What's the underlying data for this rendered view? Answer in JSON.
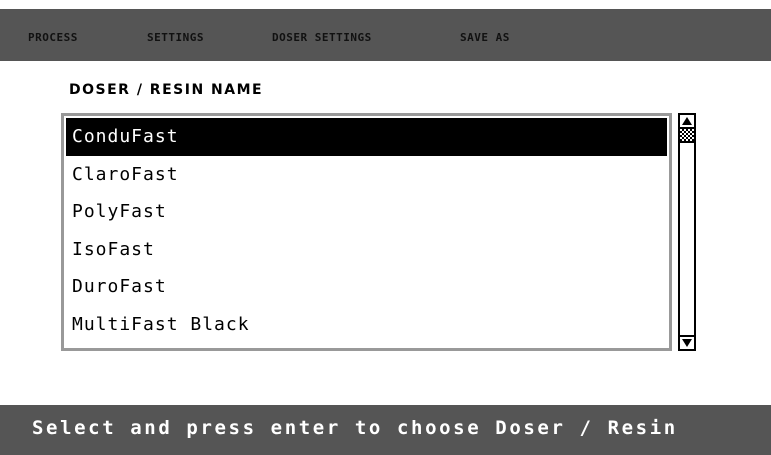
{
  "menu": {
    "items": [
      {
        "label": "PROCESS"
      },
      {
        "label": "SETTINGS"
      },
      {
        "label": "DOSER SETTINGS"
      },
      {
        "label": "SAVE AS"
      }
    ]
  },
  "section": {
    "title": "DOSER / RESIN NAME"
  },
  "list": {
    "selected": "ConduFast",
    "items": [
      {
        "label": "ConduFast"
      },
      {
        "label": "ClaroFast"
      },
      {
        "label": "PolyFast"
      },
      {
        "label": "IsoFast"
      },
      {
        "label": "DuroFast"
      },
      {
        "label": "MultiFast Black"
      }
    ]
  },
  "scrollbar": {
    "up_icon": "arrow-up-icon",
    "down_icon": "arrow-down-icon"
  },
  "status": {
    "text": "Select and press enter to choose Doser / Resin"
  },
  "colors": {
    "bar_gray": "#555555",
    "list_border": "#999999",
    "selection": "#000000"
  }
}
